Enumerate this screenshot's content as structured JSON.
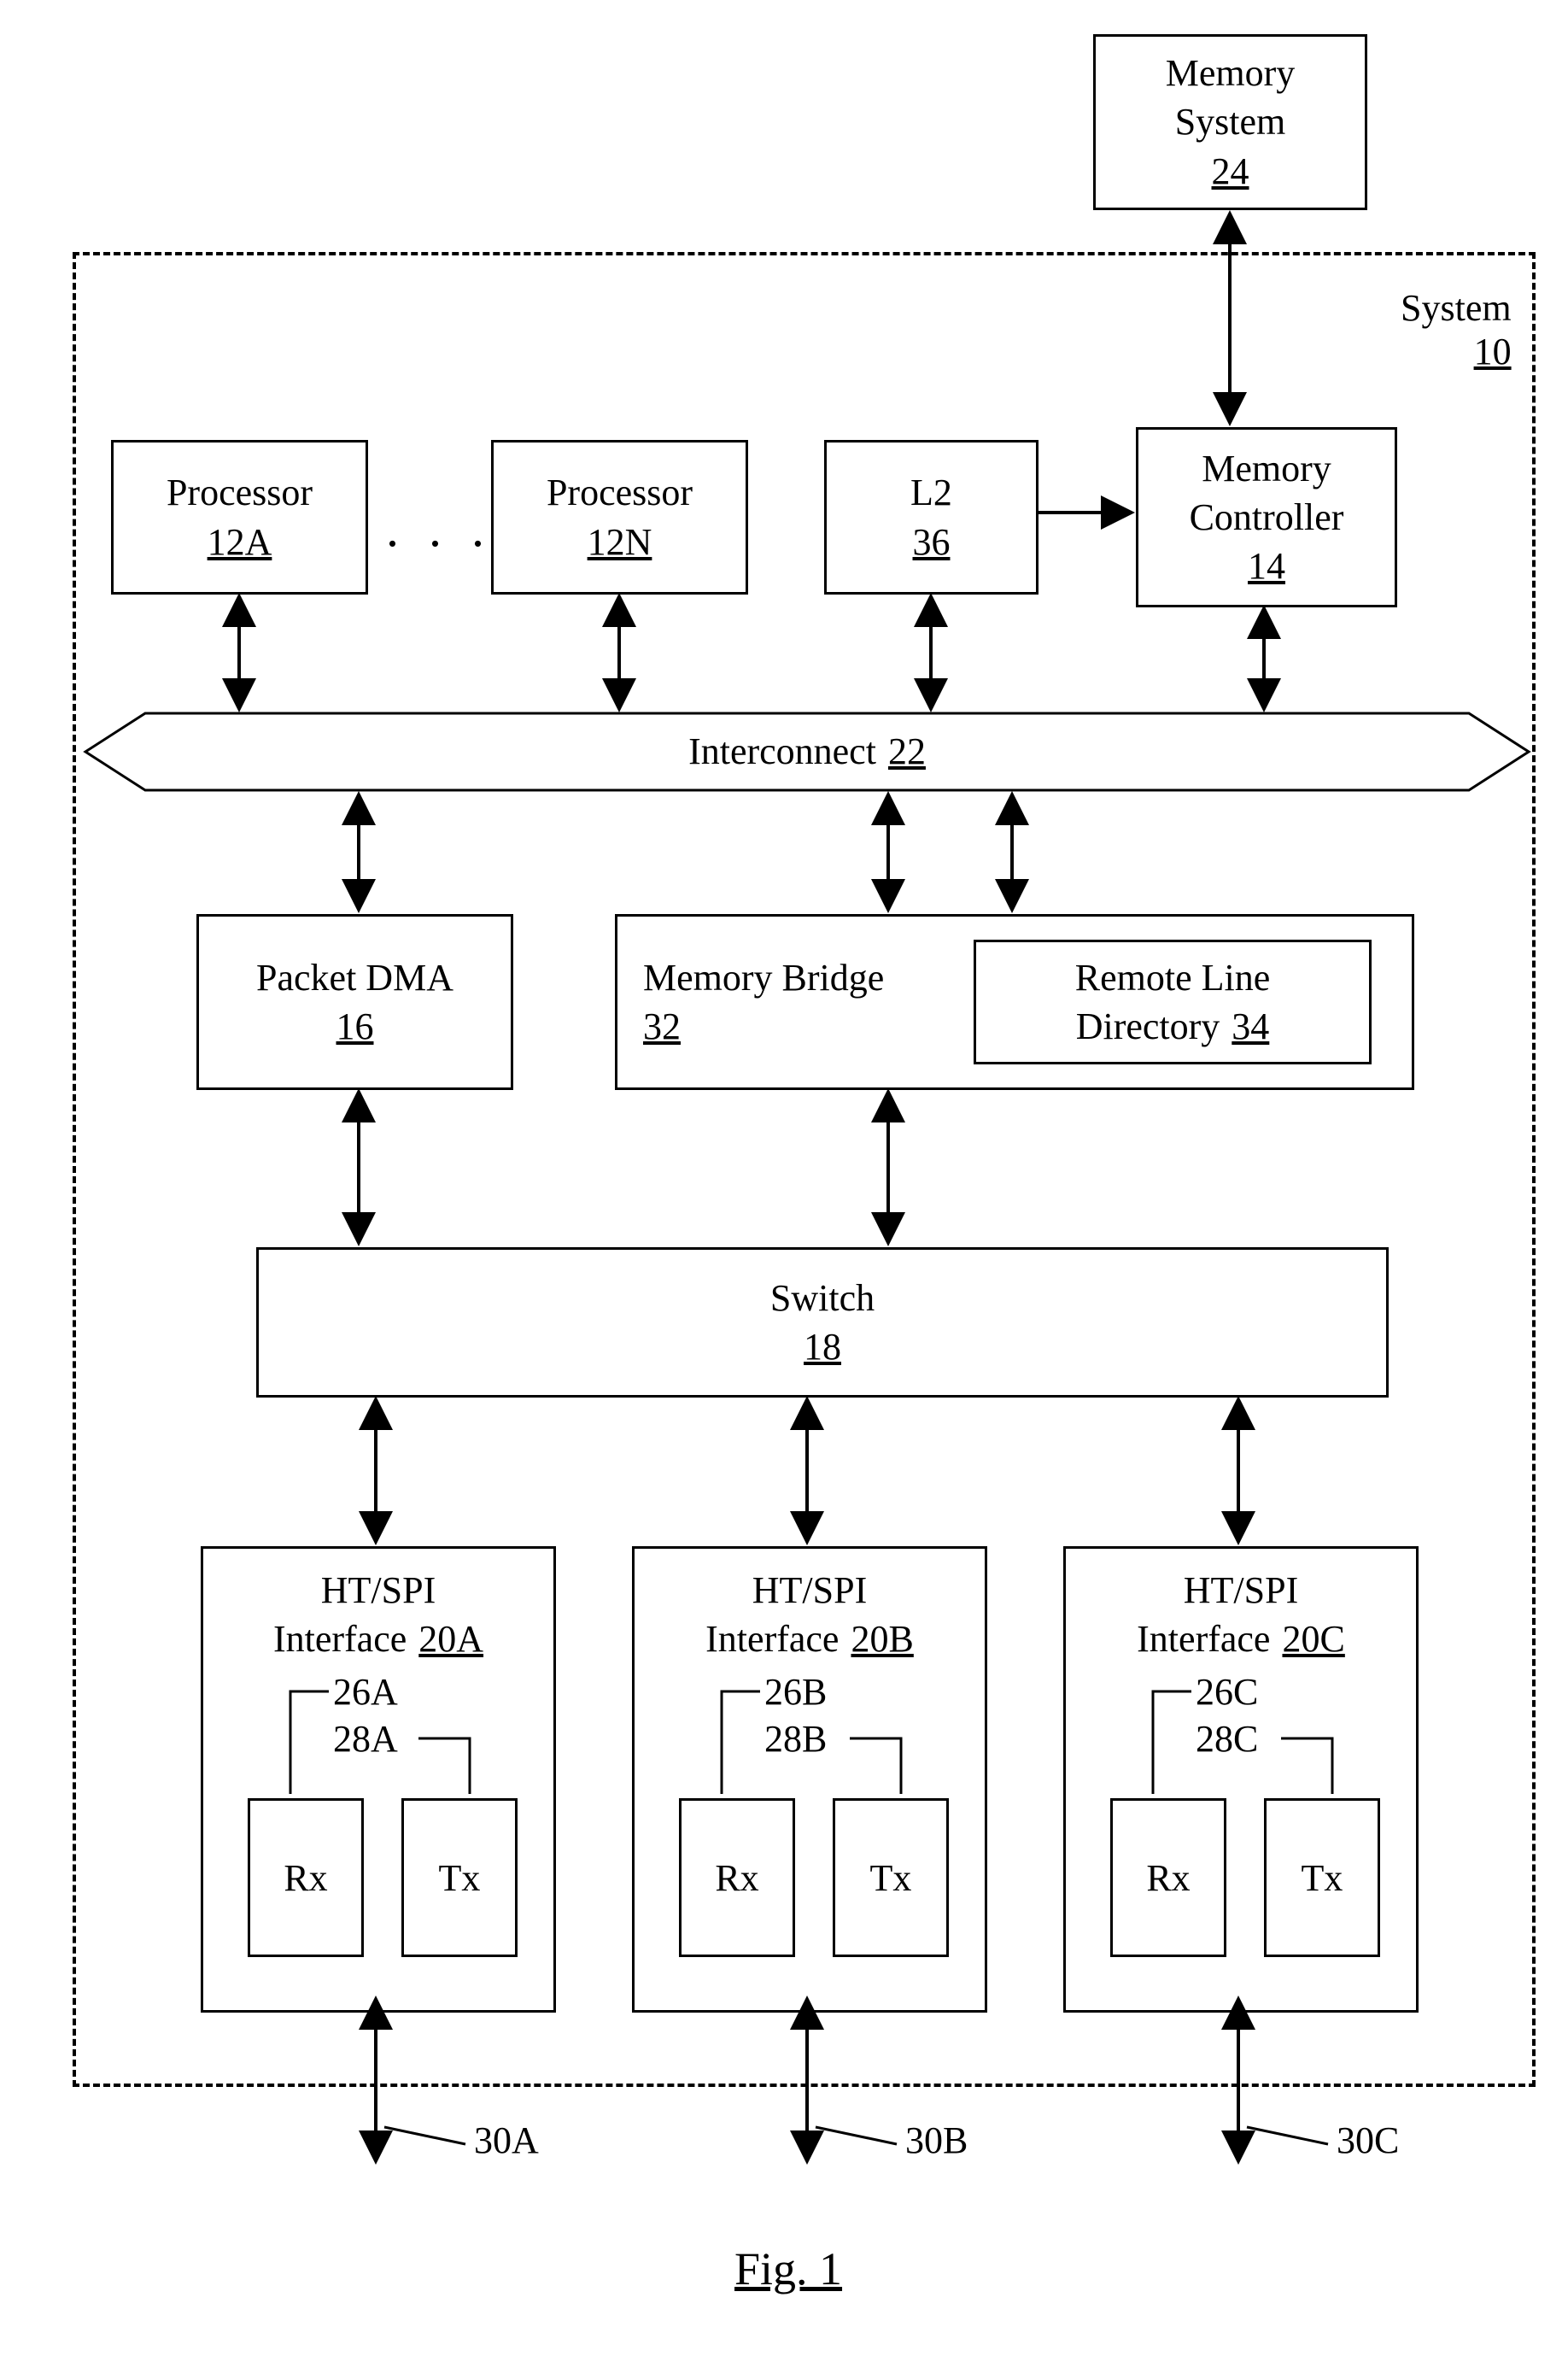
{
  "figure": "Fig. 1",
  "memory_system": {
    "l1": "Memory",
    "l2": "System",
    "ref": "24"
  },
  "system_label": {
    "l1": "System",
    "ref": "10"
  },
  "row1": {
    "processor_a": {
      "l1": "Processor",
      "ref": "12A"
    },
    "processor_n": {
      "l1": "Processor",
      "ref": "12N"
    },
    "l2": {
      "l1": "L2",
      "ref": "36"
    },
    "memctrl": {
      "l1": "Memory",
      "l2": "Controller",
      "ref": "14"
    }
  },
  "interconnect": {
    "l1": "Interconnect",
    "ref": "22"
  },
  "row3": {
    "pdma": {
      "l1": "Packet DMA",
      "ref": "16"
    },
    "membridge": {
      "l1": "Memory Bridge",
      "ref": "32"
    },
    "rld": {
      "l1": "Remote Line",
      "l2": "Directory ",
      "ref": "34"
    }
  },
  "switch": {
    "l1": "Switch",
    "ref": "18"
  },
  "interfaces": {
    "a": {
      "l1": "HT/SPI",
      "l2": "Interface ",
      "ref": "20A",
      "rx_ref": "26A",
      "tx_ref": "28A",
      "rx": "Rx",
      "tx": "Tx",
      "port": "30A"
    },
    "b": {
      "l1": "HT/SPI",
      "l2": "Interface ",
      "ref": "20B",
      "rx_ref": "26B",
      "tx_ref": "28B",
      "rx": "Rx",
      "tx": "Tx",
      "port": "30B"
    },
    "c": {
      "l1": "HT/SPI",
      "l2": "Interface ",
      "ref": "20C",
      "rx_ref": "26C",
      "tx_ref": "28C",
      "rx": "Rx",
      "tx": "Tx",
      "port": "30C"
    }
  }
}
